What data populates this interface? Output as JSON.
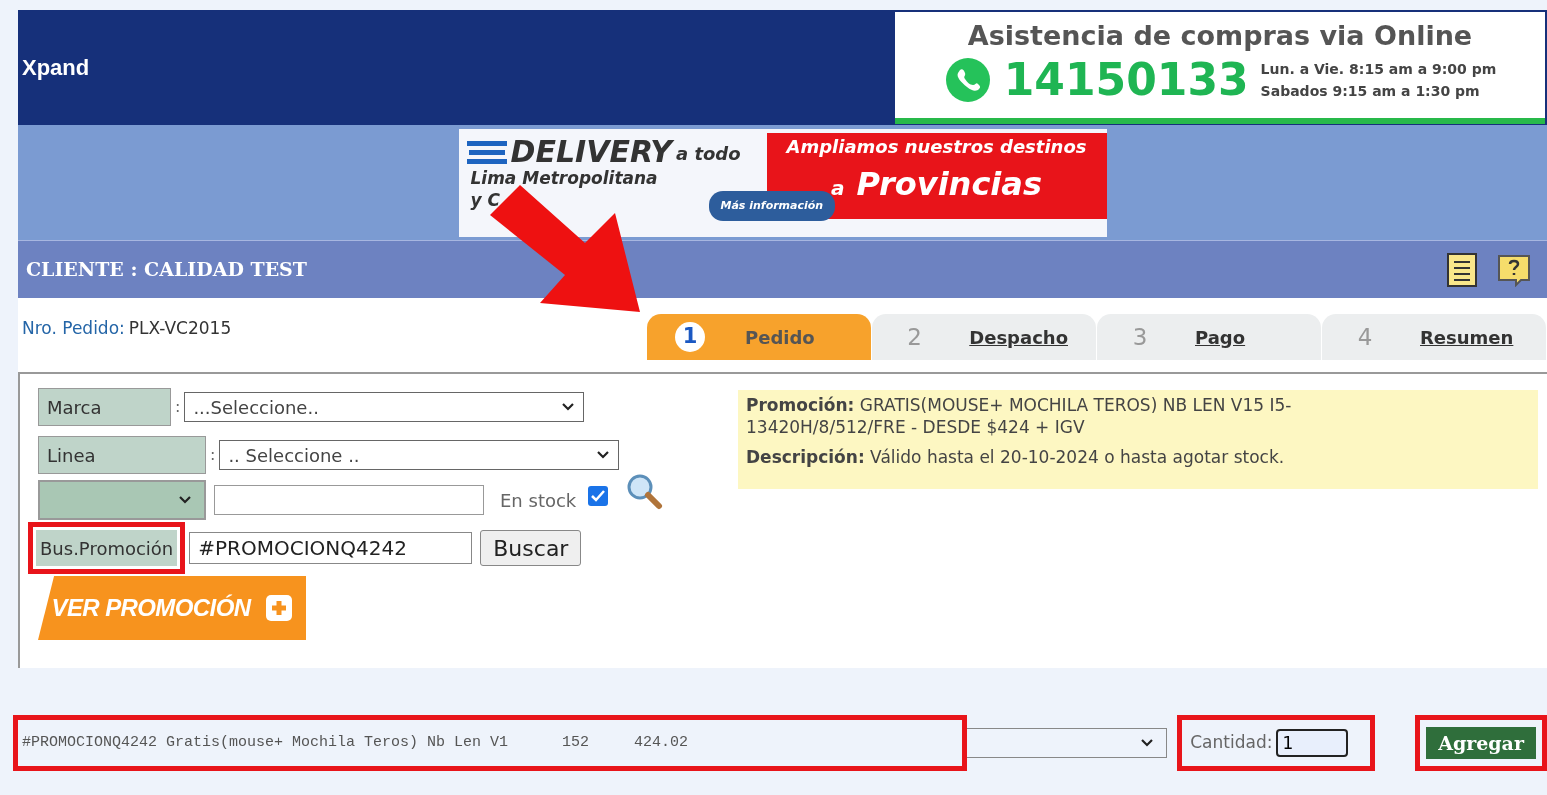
{
  "header": {
    "brand": "Xpand",
    "assist": {
      "title": "Asistencia de compras via Online",
      "phone": "14150133",
      "hours": [
        "Lun. a Vie. 8:15 am a 9:00 pm",
        "Sabados 9:15 am a 1:30 pm"
      ]
    }
  },
  "delivery_banner": {
    "headline": "DELIVERY",
    "headline_tail": "a todo",
    "sub": [
      "Lima Metropolitana",
      "y C"
    ],
    "button": "Más información",
    "promo_line": "Ampliamos nuestros destinos",
    "promo_a": "a",
    "promo_big": "Provincias"
  },
  "client_bar": {
    "title": "CLIENTE : CALIDAD TEST"
  },
  "order": {
    "label": "Nro. Pedido:",
    "value": "PLX-VC2015"
  },
  "steps": [
    {
      "number": "1",
      "label": "Pedido",
      "selected": true
    },
    {
      "number": "2",
      "label": "Despacho",
      "selected": false
    },
    {
      "number": "3",
      "label": "Pago",
      "selected": false
    },
    {
      "number": "4",
      "label": "Resumen",
      "selected": false
    }
  ],
  "filters": {
    "marca": {
      "label": "Marca",
      "sep": ":",
      "value": "...Seleccione.."
    },
    "linea": {
      "label": "Linea",
      "sep": ":",
      "value": ".. Seleccione .."
    },
    "stock": {
      "label": "En stock",
      "checked": true
    },
    "promo": {
      "label": "Bus.Promoción",
      "value": "#PROMOCIONQ4242",
      "button": "Buscar"
    },
    "ver_promo": "VER PROMOCIÓN"
  },
  "promo_info": {
    "promo_label": "Promoción:",
    "promo_text": "GRATIS(MOUSE+ MOCHILA TEROS) NB LEN V15 I5-13420H/8/512/FRE - DESDE $424 + IGV",
    "desc_label": "Descripción:",
    "desc_text": "Válido hasta el 20-10-2024 o hasta agotar stock."
  },
  "add_row": {
    "product": "#PROMOCIONQ4242 Gratis(mouse+ Mochila Teros) Nb Len V1      152     424.02",
    "qty_label": "Cantidad:",
    "qty": "1",
    "button": "Agregar"
  }
}
